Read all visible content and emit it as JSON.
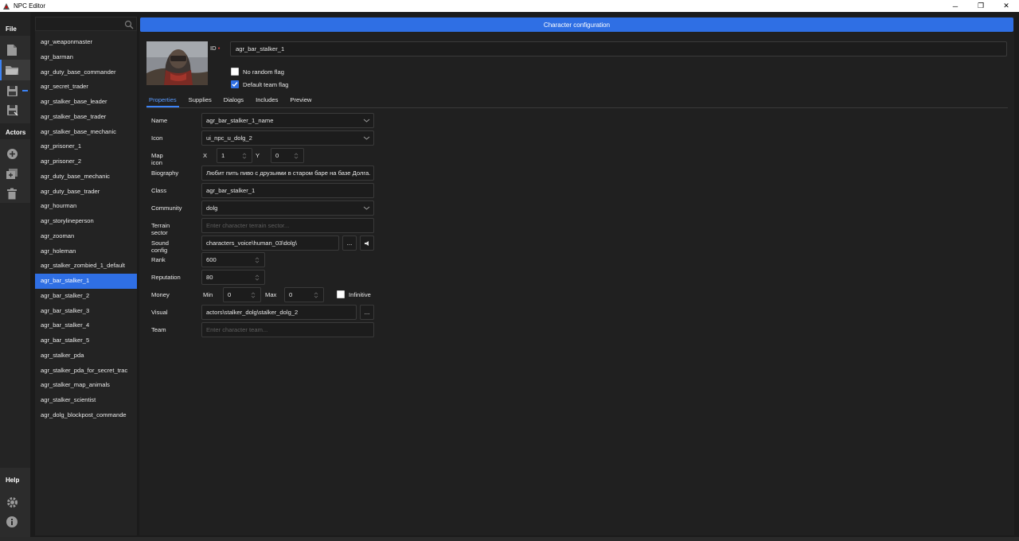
{
  "window": {
    "title": "NPC Editor",
    "minimize": "─",
    "maximize": "❐",
    "close": "✕"
  },
  "rail": {
    "file_label": "File",
    "actors_label": "Actors",
    "help_label": "Help"
  },
  "search": {
    "placeholder": ""
  },
  "list": {
    "items": [
      "agr_weaponmaster",
      "agr_barman",
      "agr_duty_base_commander",
      "agr_secret_trader",
      "agr_stalker_base_leader",
      "agr_stalker_base_trader",
      "agr_stalker_base_mechanic",
      "agr_prisoner_1",
      "agr_prisoner_2",
      "agr_duty_base_mechanic",
      "agr_duty_base_trader",
      "agr_hourman",
      "agr_storylineperson",
      "agr_zooman",
      "agr_holeman",
      "agr_stalker_zombied_1_default",
      "agr_bar_stalker_1",
      "agr_bar_stalker_2",
      "agr_bar_stalker_3",
      "agr_bar_stalker_4",
      "agr_bar_stalker_5",
      "agr_stalker_pda",
      "agr_stalker_pda_for_secret_trac",
      "agr_stalker_map_animals",
      "agr_stalker_scientist",
      "agr_dolg_blockpost_commande"
    ],
    "selected_index": 16
  },
  "header": {
    "title": "Character configuration"
  },
  "character": {
    "id_label": "ID",
    "id_required": "•",
    "id_value": "agr_bar_stalker_1",
    "no_random_flag_label": "No random flag",
    "no_random_flag_checked": false,
    "default_team_flag_label": "Default team flag",
    "default_team_flag_checked": true
  },
  "tabs": [
    "Properties",
    "Supplies",
    "Dialogs",
    "Includes",
    "Preview"
  ],
  "active_tab": "Properties",
  "form": {
    "name_label": "Name",
    "name_value": "agr_bar_stalker_1_name",
    "icon_label": "Icon",
    "icon_value": "ui_npc_u_dolg_2",
    "map_icon_label": "Map icon",
    "map_icon_x_label": "X",
    "map_icon_x": "1",
    "map_icon_y_label": "Y",
    "map_icon_y": "0",
    "biography_label": "Biography",
    "biography_value": "Любит пить пиво с друзьями в старом баре на базе Долга.",
    "class_label": "Class",
    "class_value": "agr_bar_stalker_1",
    "community_label": "Community",
    "community_value": "dolg",
    "terrain_label": "Terrain sector",
    "terrain_placeholder": "Enter character terrain sector...",
    "sound_label": "Sound config",
    "sound_value": "characters_voice\\human_03\\dolg\\",
    "browse_label": "...",
    "rank_label": "Rank",
    "rank_value": "600",
    "reputation_label": "Reputation",
    "reputation_value": "80",
    "money_label": "Money",
    "money_min_label": "Min",
    "money_min": "0",
    "money_max_label": "Max",
    "money_max": "0",
    "infinitive_label": "Infinitive",
    "infinitive_checked": false,
    "visual_label": "Visual",
    "visual_value": "actors\\stalker_dolg\\stalker_dolg_2",
    "team_label": "Team",
    "team_placeholder": "Enter character team..."
  },
  "colors": {
    "accent": "#2f6fe4",
    "background": "#1b1b1b",
    "panel": "#232323"
  }
}
